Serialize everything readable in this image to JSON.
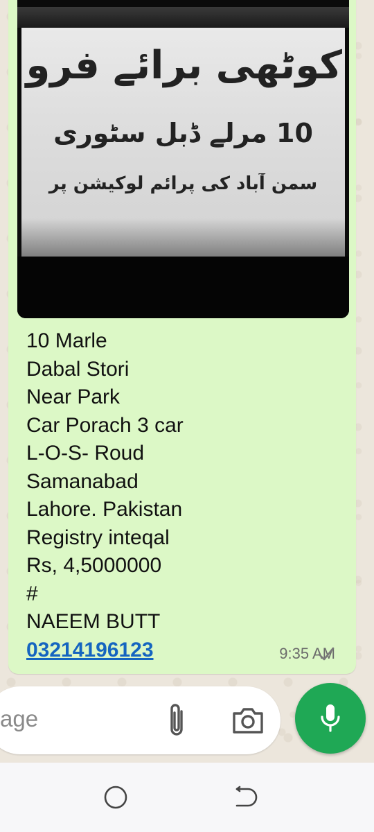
{
  "message": {
    "image_sign_lines": [
      "کوٹھی برائے فروخت",
      "10 مرلے ڈبل سٹوری",
      "سمن آباد کی پرائم لوکیشن پر"
    ],
    "lines": [
      "10 Marle",
      "Dabal Stori",
      "Near Park",
      "Car Porach 3 car",
      "L-O-S- Roud",
      "Samanabad",
      "Lahore. Pakistan",
      "Registry inteqal",
      "Rs, 4,5000000",
      "#",
      "NAEEM BUTT"
    ],
    "phone": "03214196123",
    "time": "9:35 AM",
    "status_icon": "check-icon"
  },
  "composer": {
    "placeholder": "age",
    "attach_icon": "paperclip-icon",
    "camera_icon": "camera-icon",
    "mic_icon": "microphone-icon",
    "accent": "#1fa855"
  },
  "nav": {
    "home_icon": "home-circle-icon",
    "back_icon": "back-icon"
  },
  "colors": {
    "bubble": "#dcf8c6",
    "link": "#1565c0"
  }
}
